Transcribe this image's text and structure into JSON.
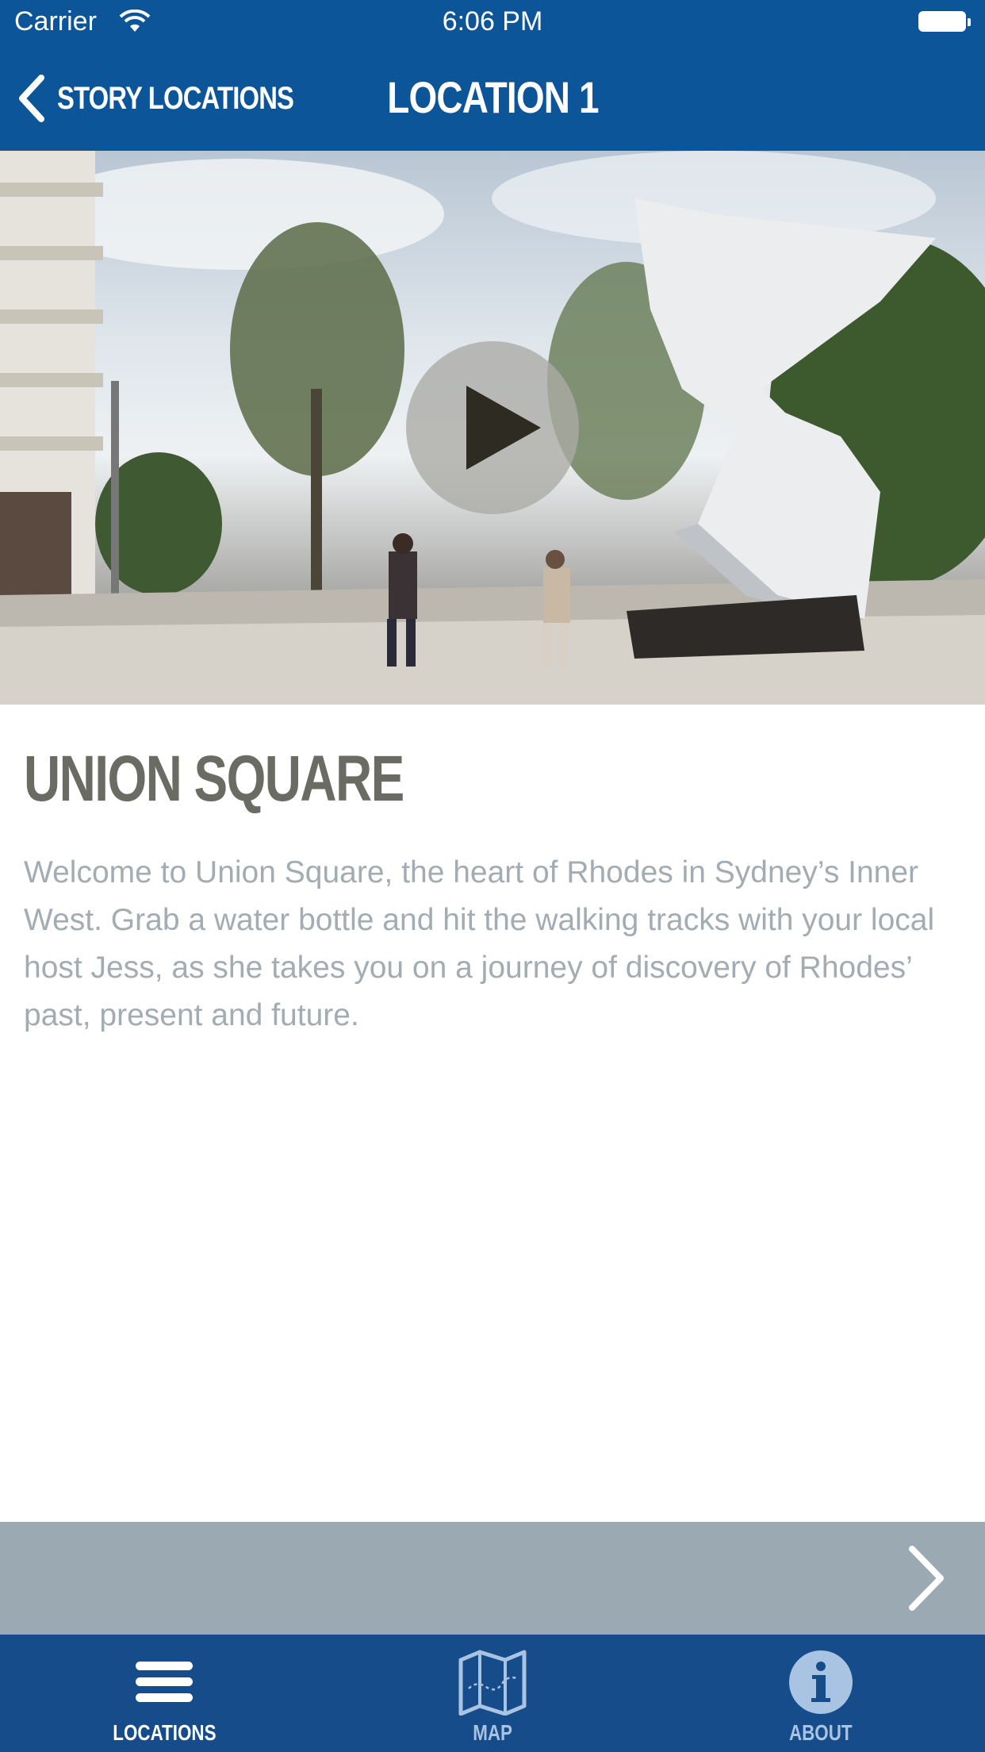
{
  "status_bar": {
    "carrier": "Carrier",
    "time": "6:06 PM"
  },
  "nav": {
    "back_label": "STORY LOCATIONS",
    "title": "LOCATION 1"
  },
  "location": {
    "title": "UNION SQUARE",
    "description": "Welcome to Union Square, the heart of Rhodes in Sydney’s Inner West. Grab a water bottle and hit the walking tracks with your local host Jess, as she takes you on a journey of discovery of Rhodes’ past, present and future."
  },
  "tabs": [
    {
      "label": "LOCATIONS",
      "icon": "hamburger-icon",
      "active": true
    },
    {
      "label": "MAP",
      "icon": "map-icon",
      "active": false
    },
    {
      "label": "ABOUT",
      "icon": "info-icon",
      "active": false
    }
  ],
  "colors": {
    "nav": "#0c5598",
    "tabbar": "#164c89",
    "next_bar": "#9ba9b2",
    "title": "#6a6b63",
    "body_text": "#a2acb2"
  }
}
